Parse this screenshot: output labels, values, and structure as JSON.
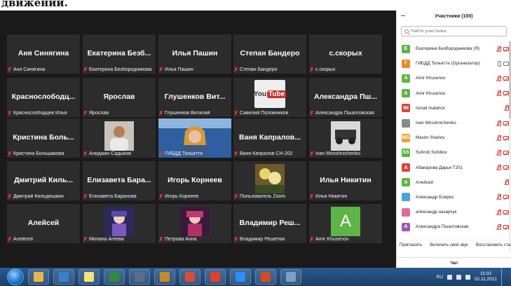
{
  "top_caption": "движении.",
  "gallery": {
    "tiles": [
      {
        "name": "Аня Синягина",
        "label": "Аня Синягина",
        "type": "name"
      },
      {
        "name": "Екатерина Безб...",
        "label": "Екатерина Безбородникова",
        "type": "name"
      },
      {
        "name": "Илья Пашин",
        "label": "Илья Пашин",
        "type": "name"
      },
      {
        "name": "Степан Бандеро",
        "label": "Степан Бандеро",
        "type": "name"
      },
      {
        "name": "с.скорых",
        "label": "с.скорых",
        "type": "name"
      },
      {
        "name": "Краснослободц...",
        "label": "Краснослободцев Илья",
        "type": "name"
      },
      {
        "name": "Ярослав",
        "label": "Ярослав",
        "type": "name"
      },
      {
        "name": "Глушенков Вит...",
        "label": "Глушенков Виталий",
        "type": "name"
      },
      {
        "name": "",
        "label": "Савелий Половников",
        "type": "youtube",
        "yt_you": "You",
        "yt_tube": "Tube"
      },
      {
        "name": "Александра Пш...",
        "label": "Александра Пшалговская",
        "type": "name"
      },
      {
        "name": "Кристина Боль...",
        "label": "Кристина Большакова",
        "type": "name"
      },
      {
        "name": "",
        "label": "Алиджан Садыков",
        "type": "photo-man"
      },
      {
        "name": "",
        "label": "ГИБДД Тольятти",
        "type": "video-active"
      },
      {
        "name": "Ваня Капралов...",
        "label": "Ваня Капралов СН-202",
        "type": "name"
      },
      {
        "name": "",
        "label": "Ivan Miroshnichenko",
        "type": "photo-bw"
      },
      {
        "name": "Дмитрий Киль...",
        "label": "Дмитрий Кильдюшкин",
        "type": "name"
      },
      {
        "name": "Елизавета Бара...",
        "label": "Елизавета Баранова",
        "type": "name"
      },
      {
        "name": "Игорь Корнеев",
        "label": "Игорь Корнеев",
        "type": "name"
      },
      {
        "name": "",
        "label": "Пользователь Zoom",
        "type": "photo-flowers"
      },
      {
        "name": "Илья Никитин",
        "label": "Илья Никитин",
        "type": "name"
      },
      {
        "name": "Алейсей",
        "label": "Алейсей",
        "type": "name"
      },
      {
        "name": "",
        "label": "Милана Агеева",
        "type": "photo-anime1"
      },
      {
        "name": "",
        "label": "Петрова Анна",
        "type": "photo-anime2"
      },
      {
        "name": "Владимир Реш...",
        "label": "Владимир Решетюк",
        "type": "name"
      },
      {
        "name": "",
        "label": "Amir Khusenov",
        "type": "green-avatar",
        "avatar_letter": "A"
      }
    ]
  },
  "sidebar": {
    "title": "Участники (100)",
    "search_placeholder": "Найти участника",
    "participants": [
      {
        "letter": "E",
        "color": "#5eb446",
        "name": "Екатерина Безбородникова (Я)",
        "mic": "off",
        "cam": "off"
      },
      {
        "letter": "Г",
        "color": "#f08a24",
        "name": "ГИБДД Тольятти (Организатор)",
        "mic": "on",
        "cam": "on"
      },
      {
        "letter": "A",
        "color": "#5eb446",
        "name": "Amir Khusenov",
        "mic": "off",
        "cam": "off"
      },
      {
        "letter": "A",
        "color": "#5eb446",
        "name": "Amir Khusenov",
        "mic": "off",
        "cam": "off"
      },
      {
        "letter": "IM",
        "color": "#d9443c",
        "name": "Ismail malahov",
        "mic": "off",
        "cam": "none"
      },
      {
        "letter": "",
        "color": "#8a8a8a",
        "name": "Ivan Miroshnichenko",
        "mic": "off",
        "cam": "off"
      },
      {
        "letter": "MS",
        "color": "#f0a23a",
        "name": "Maxim Shahov",
        "mic": "off",
        "cam": "off"
      },
      {
        "letter": "SS",
        "color": "#5eb446",
        "name": "Suhrob Sohibov",
        "mic": "off",
        "cam": "off"
      },
      {
        "letter": "A",
        "color": "#d9443c",
        "name": "Абакарова Дарья Т201",
        "mic": "off",
        "cam": "off"
      },
      {
        "letter": "A",
        "color": "#5eb446",
        "name": "Алейсей",
        "mic": "off",
        "cam": "none"
      },
      {
        "letter": "",
        "color": "#4aa3df",
        "name": "Александр Боярко",
        "mic": "off",
        "cam": "off"
      },
      {
        "letter": "",
        "color": "#e06aa0",
        "name": "александр назарчук",
        "mic": "off",
        "cam": "off"
      },
      {
        "letter": "A",
        "color": "#9b59b6",
        "name": "Александра Пшалговская",
        "mic": "off",
        "cam": "off"
      }
    ],
    "actions": {
      "invite": "Пригласить",
      "unmute": "Включить свой звук",
      "rename": "Восстановить ста"
    },
    "chat_label": "Чат"
  },
  "taskbar": {
    "lang": "RU",
    "time": "11:03",
    "date": "02.11.2021",
    "apps": [
      {
        "icon": "explorer-icon",
        "color": "#e8b64a"
      },
      {
        "icon": "media-player-icon",
        "color": "#3a7fd0"
      },
      {
        "icon": "notepad-icon",
        "color": "#f2e27a"
      },
      {
        "icon": "excel-icon",
        "color": "#2e8b3e"
      },
      {
        "icon": "calculator-icon",
        "color": "#5a6f85"
      },
      {
        "icon": "app-icon",
        "color": "#c48a2c"
      },
      {
        "icon": "chrome-icon",
        "color": "#d94a3a"
      },
      {
        "icon": "yandex-icon",
        "color": "#e04030"
      },
      {
        "icon": "zoom-icon",
        "color": "#2d8cff"
      },
      {
        "icon": "powerpoint-icon",
        "color": "#d04a26"
      },
      {
        "icon": "paint-icon",
        "color": "#7aa0c8"
      }
    ]
  }
}
